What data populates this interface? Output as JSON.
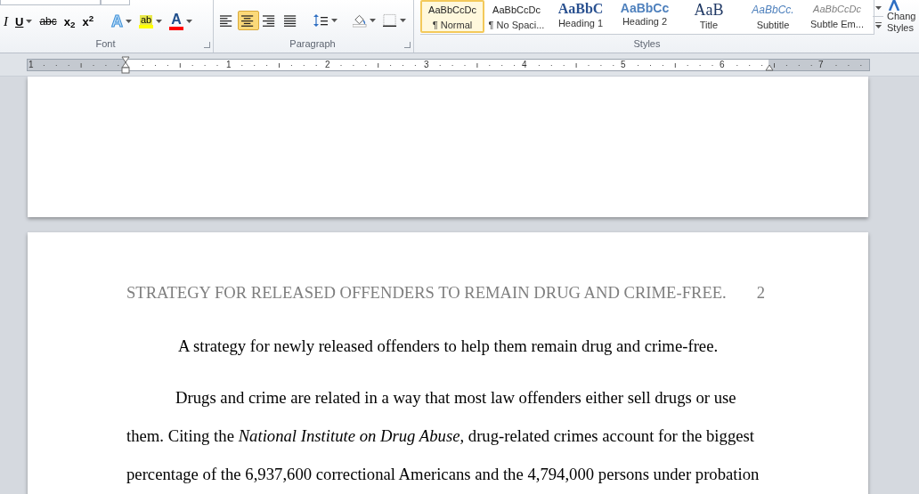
{
  "ribbon": {
    "font_buttons": [
      {
        "kind": "italic",
        "label": "I",
        "dropdown": false
      },
      {
        "kind": "underline",
        "label": "U",
        "dropdown": true
      },
      {
        "kind": "strike",
        "label": "abc",
        "dropdown": false
      },
      {
        "kind": "subscript",
        "label": "x$_{2}$",
        "dropdown": false
      },
      {
        "kind": "superscript",
        "label": "x$^{2}$",
        "dropdown": false
      },
      {
        "kind": "effects",
        "label": "A",
        "dropdown": true
      },
      {
        "kind": "highlight",
        "label": "ab",
        "dropdown": true
      },
      {
        "kind": "fontcolor",
        "label": "A",
        "dropdown": true
      }
    ],
    "paragraph_buttons": [
      {
        "kind": "align-left",
        "selected": false
      },
      {
        "kind": "align-center",
        "selected": true
      },
      {
        "kind": "align-right",
        "selected": false
      },
      {
        "kind": "justify",
        "selected": false
      },
      {
        "kind": "line-spacing",
        "selected": false
      },
      {
        "kind": "shading",
        "selected": false
      },
      {
        "kind": "borders",
        "selected": false
      }
    ],
    "groups": [
      {
        "label": "Font"
      },
      {
        "label": "Paragraph"
      },
      {
        "label": "Styles"
      }
    ],
    "styles": [
      {
        "kind": "normal",
        "preview": "AaBbCcDc",
        "label": "¶ Normal",
        "selected": true
      },
      {
        "kind": "normal",
        "preview": "AaBbCcDc",
        "label": "¶ No Spaci...",
        "selected": false
      },
      {
        "kind": "heading1",
        "preview": "AaBbC",
        "label": "Heading 1",
        "selected": false
      },
      {
        "kind": "heading2",
        "preview": "AaBbCc",
        "label": "Heading 2",
        "selected": false
      },
      {
        "kind": "title",
        "preview": "AaB",
        "label": "Title",
        "selected": false
      },
      {
        "kind": "subtitle",
        "preview": "AaBbCc.",
        "label": "Subtitle",
        "selected": false
      },
      {
        "kind": "emphasis",
        "preview": "AaBbCcDc",
        "label": "Subtle Em...",
        "selected": false
      }
    ],
    "change_styles": {
      "label": "Chang",
      "label_2": "Styles"
    }
  },
  "ruler": {
    "labels": [
      "1",
      "1",
      "2",
      "3",
      "4",
      "5",
      "6",
      "7"
    ]
  },
  "document": {
    "header": "STRATEGY FOR RELEASED OFFENDERS TO REMAIN DRUG AND CRIME-FREE.",
    "page_number": "2",
    "title": "A strategy for newly released offenders to help them remain drug and crime-free.",
    "paragraph": "Drugs and crime are related in a way that most law offenders either sell drugs or use them. Citing the *National Institute on Drug Abuse*, drug-related crimes account for the biggest percentage of the 6,937,600 correctional Americans and the 4,794,000 persons under probation"
  }
}
